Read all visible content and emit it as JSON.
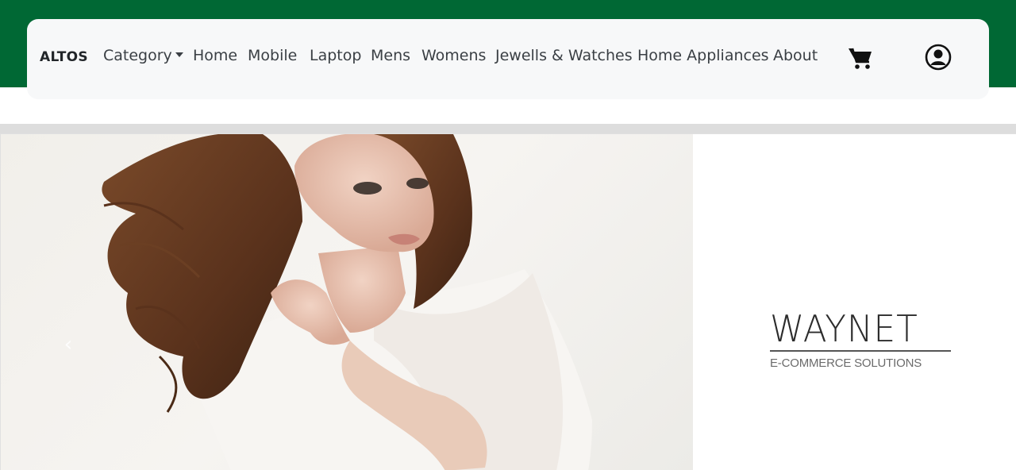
{
  "navbar": {
    "brand": "ALTOS",
    "category": "Category",
    "links": [
      "Home",
      "Mobile",
      "Laptop",
      "Mens",
      "Womens",
      "Jewells & Watches",
      "Home Appliances",
      "About"
    ]
  },
  "icons": {
    "cart": "cart-icon",
    "account": "account-icon",
    "prev": "chevron-left-icon"
  },
  "carousel": {
    "prev_glyph": "‹",
    "logo": {
      "title": "WAYNET",
      "subtitle": "E-COMMERCE SOLUTIONS"
    }
  },
  "colors": {
    "header_band": "#006834",
    "navbar_bg": "#f7f8f9",
    "divider": "#dddddd"
  }
}
